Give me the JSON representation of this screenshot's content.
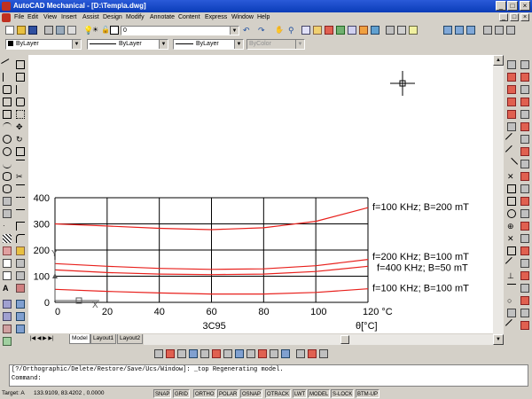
{
  "window": {
    "title": "AutoCAD Mechanical - [D:\\Temp\\a.dwg]",
    "min_glyph": "_",
    "max_glyph": "□",
    "close_glyph": "×"
  },
  "menu": [
    "File",
    "Edit",
    "View",
    "Insert",
    "Assist",
    "Design",
    "Modify",
    "Annotate",
    "Content",
    "Express",
    "Window",
    "Help"
  ],
  "toolbar": {
    "layer_value": "0"
  },
  "properties": {
    "color": "ByLayer",
    "linetype": "ByLayer",
    "lineweight": "ByLayer",
    "plotstyle": "ByColor"
  },
  "chart_data": {
    "type": "line",
    "xlim": [
      0,
      120
    ],
    "ylim": [
      0,
      400
    ],
    "x_ticks": [
      "0",
      "20",
      "40",
      "60",
      "80",
      "100",
      "120 °C"
    ],
    "y_ticks": [
      "0",
      "100",
      "200",
      "300",
      "400"
    ],
    "material_label": "3C95",
    "xlabel": "θ[°C]",
    "grid": true,
    "ucs_x": "X",
    "ucs_y": "Y",
    "series": [
      {
        "name": "f=100 KHz; B=200 mT",
        "x": [
          0,
          20,
          40,
          60,
          80,
          100,
          120
        ],
        "y": [
          300,
          292,
          283,
          278,
          285,
          310,
          362
        ]
      },
      {
        "name": "f=200 KHz; B=100 mT",
        "x": [
          0,
          20,
          40,
          60,
          80,
          100,
          120
        ],
        "y": [
          148,
          138,
          130,
          126,
          128,
          140,
          164
        ]
      },
      {
        "name": "f=400 KHz; B=50 mT",
        "x": [
          0,
          20,
          40,
          60,
          80,
          100,
          120
        ],
        "y": [
          124,
          114,
          108,
          106,
          108,
          118,
          138
        ]
      },
      {
        "name": "f=100 KHz; B=100 mT",
        "x": [
          0,
          20,
          40,
          60,
          80,
          100,
          120
        ],
        "y": [
          50,
          42,
          36,
          32,
          32,
          38,
          52
        ]
      }
    ],
    "line_color": "#e8201c"
  },
  "tabs": [
    "Model",
    "Layout1",
    "Layout2"
  ],
  "command": {
    "history": "[?/Orthographic/Delete/Restore/Save/Ucs/Window]: _top Regenerating model.",
    "prompt": "Command:"
  },
  "status": {
    "coords_label": "Target: A",
    "coords": "133.9109, 83.4202 , 0.0000",
    "buttons": [
      "SNAP",
      "GRID",
      "ORTHO",
      "POLAR",
      "OSNAP",
      "OTRACK",
      "LWT",
      "MODEL",
      "S-LOCK",
      "BTM-UP"
    ]
  }
}
